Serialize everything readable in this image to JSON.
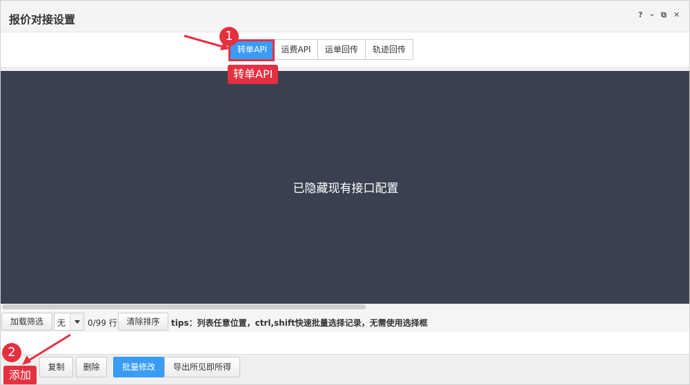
{
  "window": {
    "title": "报价对接设置",
    "controls": {
      "help": "?",
      "minimize": "–",
      "popout": "⧉",
      "close": "✕"
    }
  },
  "tabs": [
    {
      "label": "转单API",
      "active": true
    },
    {
      "label": "运费API",
      "active": false
    },
    {
      "label": "运单回传",
      "active": false
    },
    {
      "label": "轨迹回传",
      "active": false
    }
  ],
  "overlay": {
    "message": "已隐藏现有接口配置"
  },
  "filterbar": {
    "load_filter": "加载筛选",
    "select_value": "无",
    "row_count": "0/99 行",
    "clear_sort": "清除排序",
    "tips": "tips：列表任意位置，ctrl,shift快速批量选择记录，无需使用选择框"
  },
  "actions": {
    "copy": "复制",
    "delete": "删除",
    "batch_edit": "批量修改",
    "export": "导出所见即所得"
  },
  "annotations": [
    {
      "number": "1",
      "label": "转单API"
    },
    {
      "number": "2",
      "label": "添加"
    }
  ],
  "colors": {
    "accent": "#3a9cf5",
    "annotation": "#e53040",
    "overlay": "#394150"
  }
}
